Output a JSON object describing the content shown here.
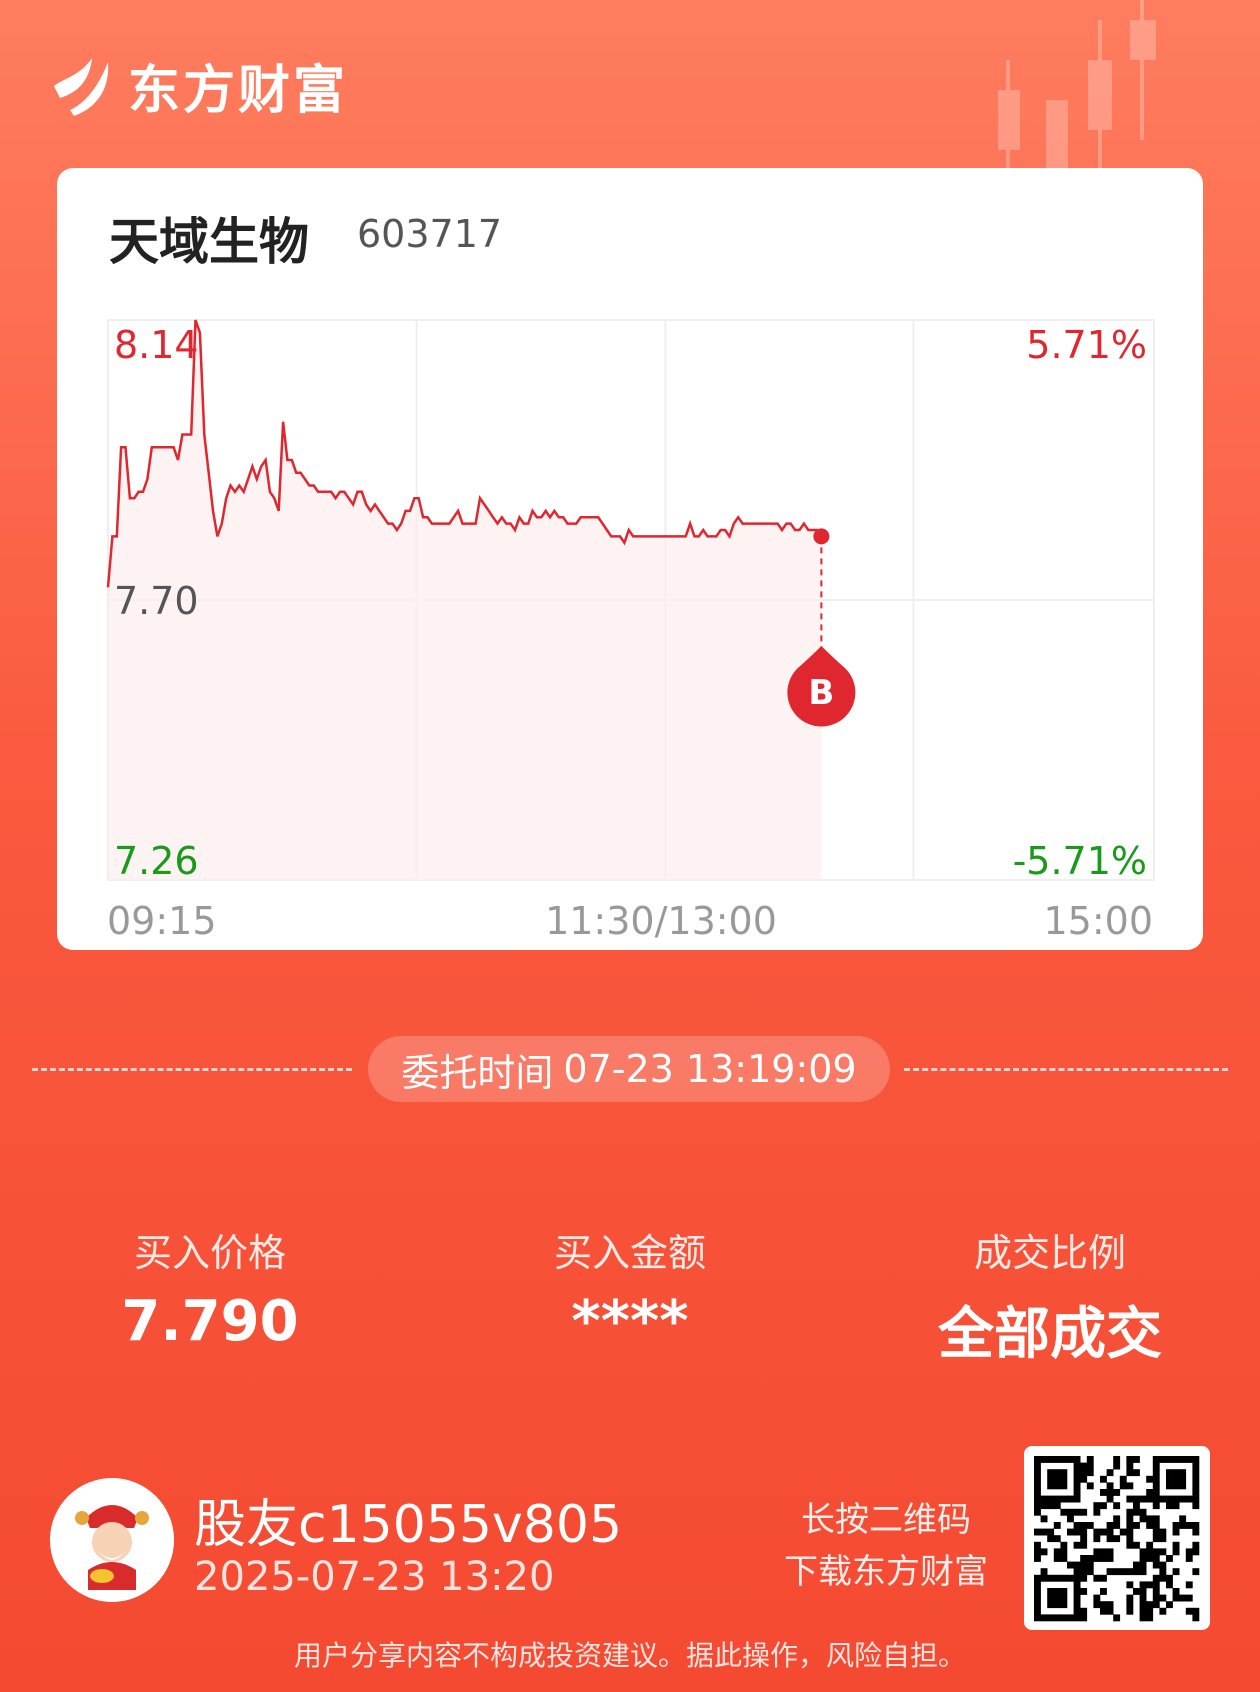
{
  "brand": {
    "name": "东方财富"
  },
  "stock": {
    "name": "天域生物",
    "code": "603717"
  },
  "chart_data": {
    "type": "line",
    "title": "",
    "y_axis_left": {
      "top": "8.14",
      "mid": "7.70",
      "bottom": "7.26"
    },
    "y_axis_right": {
      "top": "5.71%",
      "bottom": "-5.71%"
    },
    "x_labels": [
      "09:15",
      "11:30/13:00",
      "15:00"
    ],
    "ylim": [
      7.26,
      8.14
    ],
    "prev_close": 7.7,
    "colors": {
      "line": "#e0262e",
      "up": "#e0262e",
      "down": "#1a9a1a",
      "neutral": "#555555"
    },
    "series": [
      {
        "values": [
          7.72,
          7.8,
          7.8,
          7.94,
          7.94,
          7.86,
          7.86,
          7.87,
          7.87,
          7.89,
          7.94,
          7.94,
          7.94,
          7.94,
          7.94,
          7.94,
          7.92,
          7.96,
          7.96,
          7.96,
          8.14,
          8.12,
          7.96,
          7.9,
          7.84,
          7.8,
          7.82,
          7.86,
          7.88,
          7.87,
          7.88,
          7.87,
          7.89,
          7.91,
          7.89,
          7.91,
          7.92,
          7.87,
          7.86,
          7.84,
          7.98,
          7.92,
          7.92,
          7.9,
          7.9,
          7.89,
          7.88,
          7.88,
          7.87,
          7.87,
          7.87,
          7.87,
          7.86,
          7.87,
          7.87,
          7.86,
          7.85,
          7.87,
          7.87,
          7.85,
          7.84,
          7.85,
          7.84,
          7.83,
          7.82,
          7.82,
          7.81,
          7.82,
          7.84,
          7.84,
          7.86,
          7.86,
          7.83,
          7.83,
          7.82,
          7.82,
          7.82,
          7.82,
          7.82,
          7.83,
          7.84,
          7.82,
          7.82,
          7.82,
          7.82,
          7.86,
          7.85,
          7.84,
          7.83,
          7.82,
          7.83,
          7.82,
          7.82,
          7.81,
          7.83,
          7.82,
          7.82,
          7.84,
          7.83,
          7.83,
          7.84,
          7.83,
          7.84,
          7.83,
          7.83,
          7.82,
          7.82,
          7.82,
          7.83,
          7.83,
          7.83,
          7.83,
          7.83,
          7.82,
          7.81,
          7.8,
          7.8,
          7.8,
          7.79,
          7.81,
          7.8,
          7.8,
          7.8,
          7.8,
          7.8,
          7.8,
          7.8,
          7.8,
          7.8,
          7.8,
          7.8,
          7.8,
          7.8,
          7.82,
          7.8,
          7.8,
          7.81,
          7.8,
          7.8,
          7.8,
          7.81,
          7.81,
          7.8,
          7.82,
          7.83,
          7.82,
          7.82,
          7.82,
          7.82,
          7.82,
          7.82,
          7.82,
          7.82,
          7.82,
          7.81,
          7.82,
          7.82,
          7.81,
          7.81,
          7.82,
          7.81,
          7.81,
          7.81,
          7.8
        ],
        "total_slots": 240
      }
    ],
    "marker": {
      "label": "B",
      "price": 7.8
    }
  },
  "order": {
    "label": "委托时间",
    "time": "07-23 13:19:09"
  },
  "stats": [
    {
      "label": "买入价格",
      "value": "7.790"
    },
    {
      "label": "买入金额",
      "value": "****"
    },
    {
      "label": "成交比例",
      "value": "全部成交"
    }
  ],
  "user": {
    "name": "股友c15055v805",
    "time": "2025-07-23 13:20"
  },
  "qr_tip": {
    "line1": "长按二维码",
    "line2": "下载东方财富"
  },
  "disclaimer": "用户分享内容不构成投资建议。据此操作，风险自担。"
}
